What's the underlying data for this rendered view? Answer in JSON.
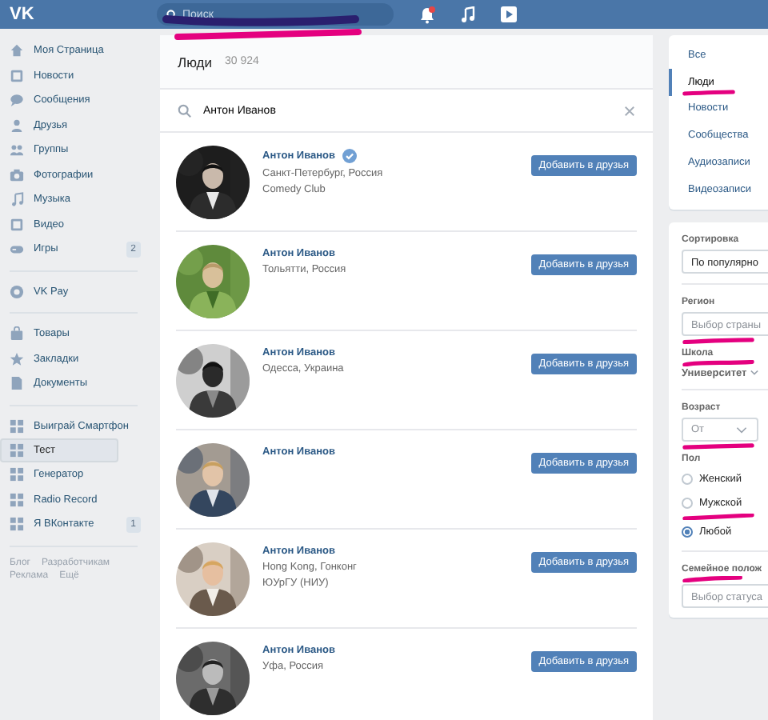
{
  "header": {
    "logo": "VK",
    "search": {
      "placeholder": "Поиск"
    }
  },
  "sidebar": {
    "groups": [
      {
        "items": [
          {
            "label": "Моя Страница",
            "selected": false
          },
          {
            "label": "Новости",
            "selected": false
          },
          {
            "label": "Сообщения",
            "selected": false
          },
          {
            "label": "Друзья",
            "selected": false
          },
          {
            "label": "Группы",
            "selected": false
          },
          {
            "label": "Фотографии",
            "selected": false
          },
          {
            "label": "Музыка",
            "selected": false
          },
          {
            "label": "Видео",
            "selected": false
          },
          {
            "label": "Игры",
            "count": "2",
            "selected": false
          }
        ]
      },
      {
        "items": [
          {
            "label": "VK Pay",
            "selected": false
          }
        ]
      },
      {
        "items": [
          {
            "label": "Товары",
            "selected": false
          },
          {
            "label": "Закладки",
            "selected": false
          },
          {
            "label": "Документы",
            "selected": false
          }
        ]
      },
      {
        "items": [
          {
            "label": "Выиграй Смартфон",
            "selected": false
          },
          {
            "label": "Тест",
            "selected": true
          },
          {
            "label": "Генератор",
            "selected": false
          },
          {
            "label": "Radio Record",
            "selected": false
          },
          {
            "label": "Я ВКонтакте",
            "count": "1",
            "selected": false
          }
        ]
      }
    ],
    "footer_links": [
      "Блог",
      "Разработчикам",
      "Реклама",
      "Ещё"
    ]
  },
  "results": {
    "title": "Люди",
    "count": "30 924",
    "query": "Антон Иванов",
    "people": [
      {
        "name": "Антон Иванов",
        "verified": true,
        "lines": [
          "Санкт-Петербург, Россия",
          "Comedy Club"
        ],
        "button": "Добавить в друзья"
      },
      {
        "name": "Антон Иванов",
        "verified": false,
        "lines": [
          "Тольятти, Россия"
        ],
        "button": "Добавить в друзья"
      },
      {
        "name": "Антон Иванов",
        "verified": false,
        "lines": [
          "Одесса, Украина"
        ],
        "button": "Добавить в друзья"
      },
      {
        "name": "Антон Иванов",
        "verified": false,
        "button": "Добавить в друзья"
      },
      {
        "name": "Антон Иванов",
        "verified": false,
        "lines": [
          "Hong Kong, Гонконг",
          "ЮУрГУ (НИУ)"
        ],
        "button": "Добавить в друзья"
      },
      {
        "name": "Антон Иванов",
        "verified": false,
        "lines": [
          "Уфа, Россия"
        ],
        "button": "Добавить в друзья"
      }
    ]
  },
  "filters": {
    "tabs": [
      {
        "label": "Все",
        "selected": false
      },
      {
        "label": "Люди",
        "selected": true
      },
      {
        "label": "Новости",
        "selected": false
      },
      {
        "label": "Сообщества",
        "selected": false
      },
      {
        "label": "Аудиозаписи",
        "selected": false
      },
      {
        "label": "Видеозаписи",
        "selected": false
      }
    ],
    "sort": {
      "label": "Сортировка",
      "value": "По популярно"
    },
    "region": {
      "label": "Регион",
      "placeholder": "Выбор страны"
    },
    "school": {
      "label": "Школа",
      "value": "Университет"
    },
    "age": {
      "label": "Возраст",
      "placeholder": "От"
    },
    "gender": {
      "label": "Пол",
      "options": [
        {
          "label": "Женский",
          "selected": false
        },
        {
          "label": "Мужской",
          "selected": false
        },
        {
          "label": "Любой",
          "selected": true
        }
      ]
    },
    "relationship": {
      "label": "Семейное полож",
      "placeholder": "Выбор статуса"
    }
  }
}
